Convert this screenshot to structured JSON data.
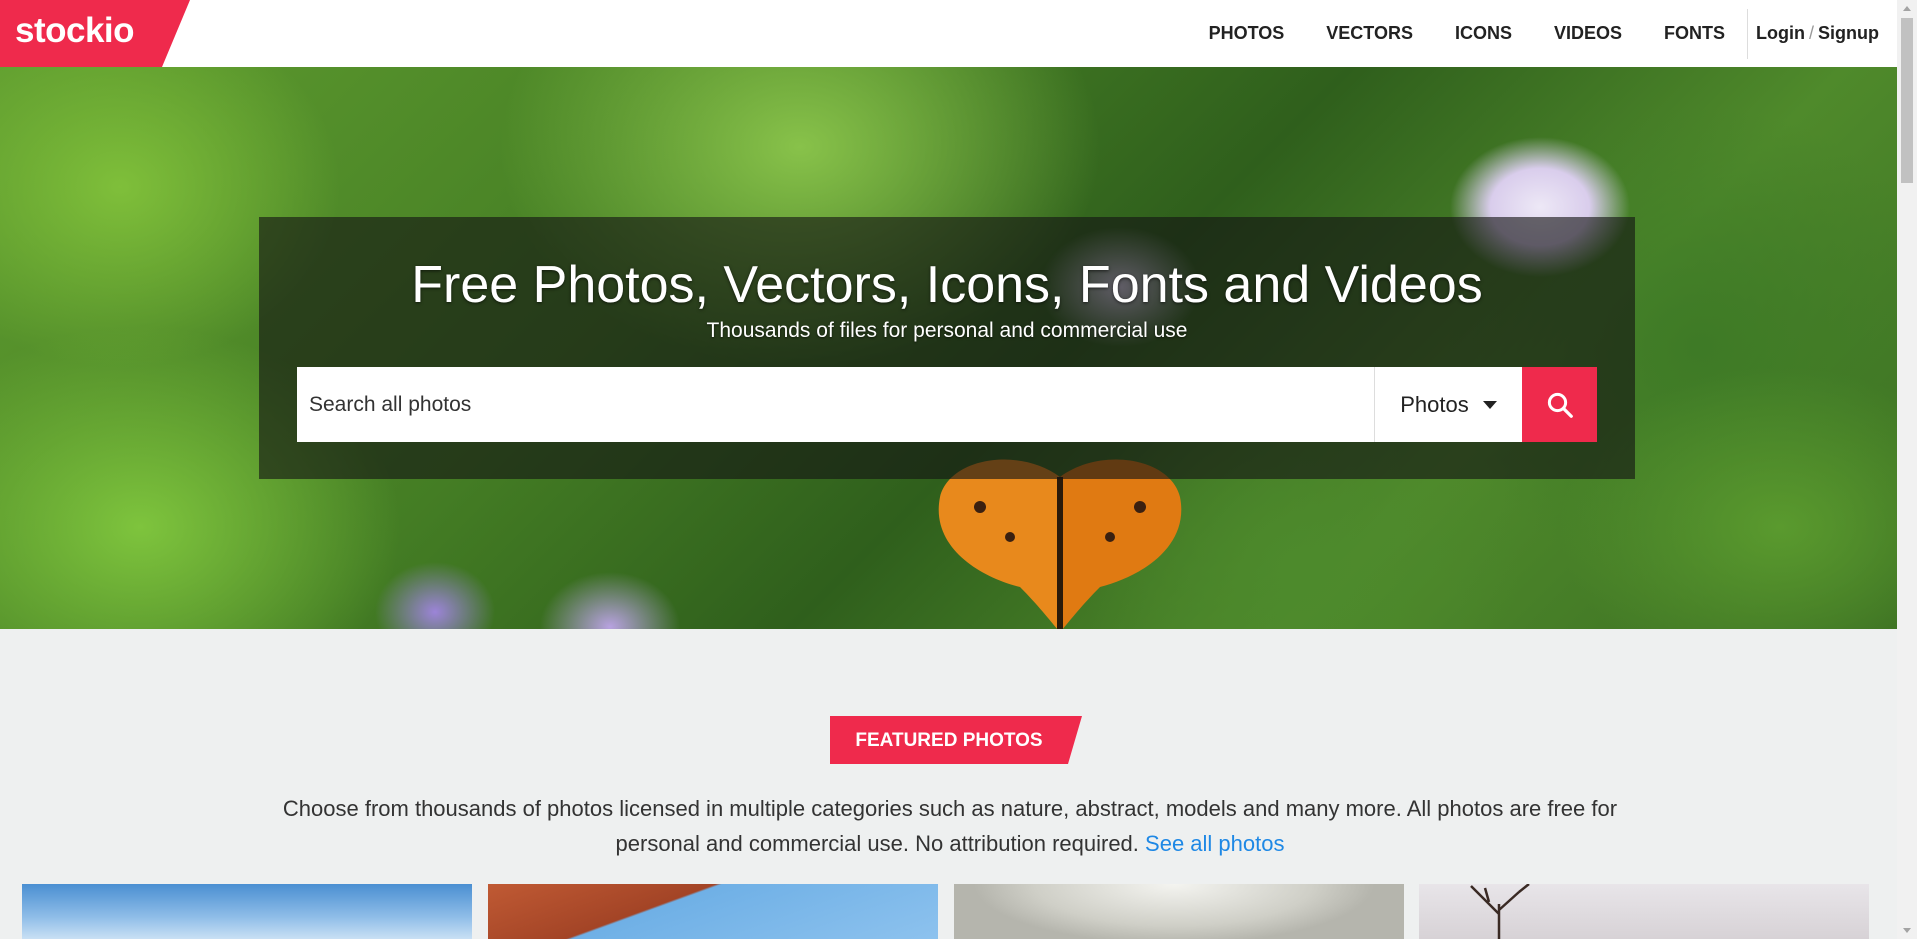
{
  "brand": {
    "name": "stockio",
    "color": "#ef2a4c"
  },
  "nav": {
    "items": [
      "PHOTOS",
      "VECTORS",
      "ICONS",
      "VIDEOS",
      "FONTS"
    ],
    "login": "Login",
    "separator": "/",
    "signup": "Signup"
  },
  "hero": {
    "title": "Free Photos, Vectors, Icons, Fonts and Videos",
    "subtitle": "Thousands of files for personal and commercial use",
    "search": {
      "placeholder": "Search all photos",
      "type": "Photos",
      "button_icon": "search-icon"
    }
  },
  "featured": {
    "badge": "FEATURED PHOTOS",
    "description": "Choose from thousands of photos licensed in multiple categories such as nature, abstract, models and many more. All photos are free for personal and commercial use. No attribution required.",
    "link": "See all photos"
  },
  "colors": {
    "accent": "#ef2a4c",
    "link": "#1e88e5"
  }
}
